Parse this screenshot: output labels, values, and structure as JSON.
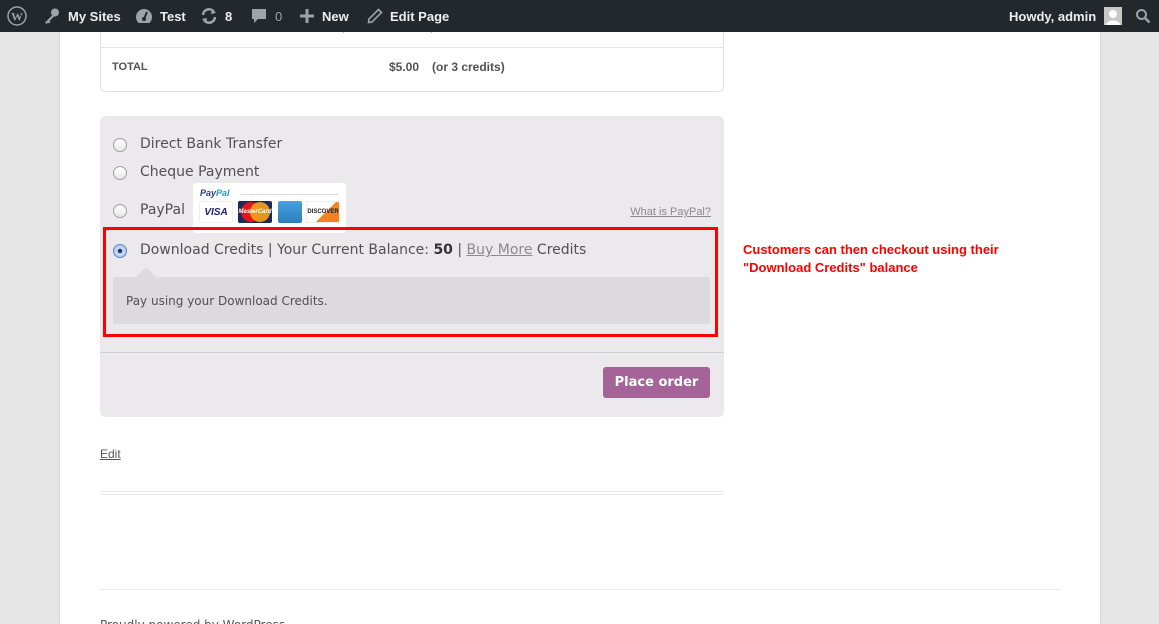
{
  "adminbar": {
    "items": [
      {
        "icon": "wordpress-logo-icon",
        "label": ""
      },
      {
        "icon": "key-icon",
        "label": "My Sites"
      },
      {
        "icon": "dashboard-icon",
        "label": "Test"
      },
      {
        "icon": "updates-icon",
        "label": "8"
      },
      {
        "icon": "comment-icon",
        "label": "0"
      },
      {
        "icon": "plus-icon",
        "label": "New"
      },
      {
        "icon": "pencil-icon",
        "label": "Edit Page"
      }
    ],
    "greeting": "Howdy, admin",
    "avatar_icon": "user-avatar-icon",
    "search_icon": "search-icon"
  },
  "order_totals": {
    "total_label": "TOTAL",
    "total_amount": "$5.00",
    "total_credits": "(or 3 credits)"
  },
  "payment": {
    "methods": [
      {
        "label": "Direct Bank Transfer",
        "selected": false
      },
      {
        "label": "Cheque Payment",
        "selected": false
      },
      {
        "label": "PayPal",
        "selected": false
      },
      {
        "label": "Download Credits",
        "selected": true
      }
    ],
    "paypal": {
      "logo_text_1": "Pay",
      "logo_text_2": "Pal",
      "cards": [
        "VISA",
        "MasterCard",
        "American Express",
        "DISCOVER"
      ],
      "card_labels": {
        "visa": "VISA",
        "mastercard": "MasterCard",
        "discover": "DISCOVER"
      },
      "what_is_link": "What is PayPal?"
    },
    "credits": {
      "prefix": "Download Credits | Your Current Balance: ",
      "balance": "50",
      "separator": " | ",
      "buy_more": "Buy More",
      "suffix": " Credits",
      "description": "Pay using your Download Credits."
    },
    "place_order_label": "Place order"
  },
  "edit_link": "Edit",
  "footer_text": "Proudly powered by WordPress",
  "annotation": {
    "text": "Customers can then checkout using their \"Download Credits\" balance",
    "color": "#ff0000"
  },
  "colors": {
    "adminbar_bg": "#23282d",
    "button_purple": "#a46497",
    "payment_bg": "#ebe9eb",
    "highlight_red": "#ff0000"
  }
}
